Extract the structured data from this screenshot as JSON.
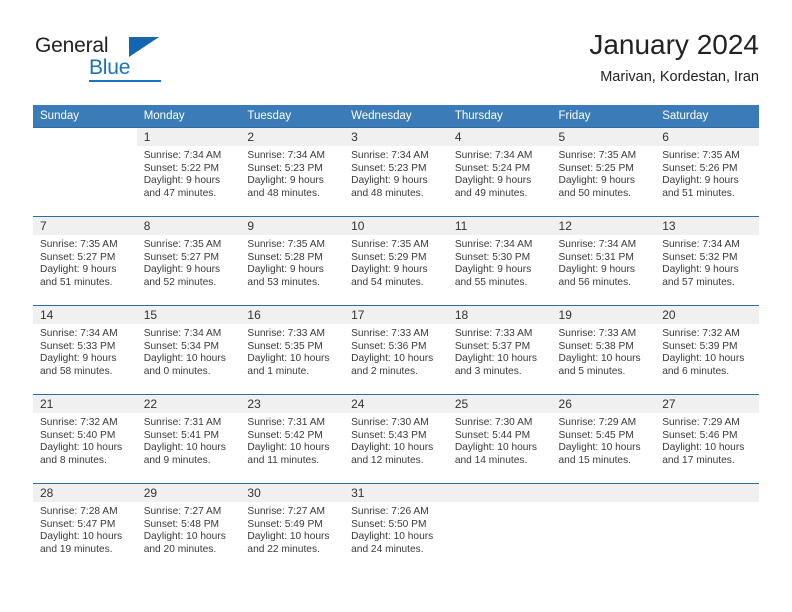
{
  "brand": {
    "name_part1": "General",
    "name_part2": "Blue"
  },
  "header": {
    "title": "January 2024",
    "subtitle": "Marivan, Kordestan, Iran"
  },
  "weekday_headers": [
    "Sunday",
    "Monday",
    "Tuesday",
    "Wednesday",
    "Thursday",
    "Friday",
    "Saturday"
  ],
  "colors": {
    "header_blue": "#3b7cb8",
    "border_blue": "#2e6da4",
    "daynum_bg": "#f0f0f0",
    "brand_blue": "#1b72bd",
    "text": "#3a3a3a"
  },
  "weeks": [
    [
      {
        "day": "",
        "empty": true,
        "lines": []
      },
      {
        "day": "1",
        "lines": [
          "Sunrise: 7:34 AM",
          "Sunset: 5:22 PM",
          "Daylight: 9 hours",
          "and 47 minutes."
        ]
      },
      {
        "day": "2",
        "lines": [
          "Sunrise: 7:34 AM",
          "Sunset: 5:23 PM",
          "Daylight: 9 hours",
          "and 48 minutes."
        ]
      },
      {
        "day": "3",
        "lines": [
          "Sunrise: 7:34 AM",
          "Sunset: 5:23 PM",
          "Daylight: 9 hours",
          "and 48 minutes."
        ]
      },
      {
        "day": "4",
        "lines": [
          "Sunrise: 7:34 AM",
          "Sunset: 5:24 PM",
          "Daylight: 9 hours",
          "and 49 minutes."
        ]
      },
      {
        "day": "5",
        "lines": [
          "Sunrise: 7:35 AM",
          "Sunset: 5:25 PM",
          "Daylight: 9 hours",
          "and 50 minutes."
        ]
      },
      {
        "day": "6",
        "lines": [
          "Sunrise: 7:35 AM",
          "Sunset: 5:26 PM",
          "Daylight: 9 hours",
          "and 51 minutes."
        ]
      }
    ],
    [
      {
        "day": "7",
        "lines": [
          "Sunrise: 7:35 AM",
          "Sunset: 5:27 PM",
          "Daylight: 9 hours",
          "and 51 minutes."
        ]
      },
      {
        "day": "8",
        "lines": [
          "Sunrise: 7:35 AM",
          "Sunset: 5:27 PM",
          "Daylight: 9 hours",
          "and 52 minutes."
        ]
      },
      {
        "day": "9",
        "lines": [
          "Sunrise: 7:35 AM",
          "Sunset: 5:28 PM",
          "Daylight: 9 hours",
          "and 53 minutes."
        ]
      },
      {
        "day": "10",
        "lines": [
          "Sunrise: 7:35 AM",
          "Sunset: 5:29 PM",
          "Daylight: 9 hours",
          "and 54 minutes."
        ]
      },
      {
        "day": "11",
        "lines": [
          "Sunrise: 7:34 AM",
          "Sunset: 5:30 PM",
          "Daylight: 9 hours",
          "and 55 minutes."
        ]
      },
      {
        "day": "12",
        "lines": [
          "Sunrise: 7:34 AM",
          "Sunset: 5:31 PM",
          "Daylight: 9 hours",
          "and 56 minutes."
        ]
      },
      {
        "day": "13",
        "lines": [
          "Sunrise: 7:34 AM",
          "Sunset: 5:32 PM",
          "Daylight: 9 hours",
          "and 57 minutes."
        ]
      }
    ],
    [
      {
        "day": "14",
        "lines": [
          "Sunrise: 7:34 AM",
          "Sunset: 5:33 PM",
          "Daylight: 9 hours",
          "and 58 minutes."
        ]
      },
      {
        "day": "15",
        "lines": [
          "Sunrise: 7:34 AM",
          "Sunset: 5:34 PM",
          "Daylight: 10 hours",
          "and 0 minutes."
        ]
      },
      {
        "day": "16",
        "lines": [
          "Sunrise: 7:33 AM",
          "Sunset: 5:35 PM",
          "Daylight: 10 hours",
          "and 1 minute."
        ]
      },
      {
        "day": "17",
        "lines": [
          "Sunrise: 7:33 AM",
          "Sunset: 5:36 PM",
          "Daylight: 10 hours",
          "and 2 minutes."
        ]
      },
      {
        "day": "18",
        "lines": [
          "Sunrise: 7:33 AM",
          "Sunset: 5:37 PM",
          "Daylight: 10 hours",
          "and 3 minutes."
        ]
      },
      {
        "day": "19",
        "lines": [
          "Sunrise: 7:33 AM",
          "Sunset: 5:38 PM",
          "Daylight: 10 hours",
          "and 5 minutes."
        ]
      },
      {
        "day": "20",
        "lines": [
          "Sunrise: 7:32 AM",
          "Sunset: 5:39 PM",
          "Daylight: 10 hours",
          "and 6 minutes."
        ]
      }
    ],
    [
      {
        "day": "21",
        "lines": [
          "Sunrise: 7:32 AM",
          "Sunset: 5:40 PM",
          "Daylight: 10 hours",
          "and 8 minutes."
        ]
      },
      {
        "day": "22",
        "lines": [
          "Sunrise: 7:31 AM",
          "Sunset: 5:41 PM",
          "Daylight: 10 hours",
          "and 9 minutes."
        ]
      },
      {
        "day": "23",
        "lines": [
          "Sunrise: 7:31 AM",
          "Sunset: 5:42 PM",
          "Daylight: 10 hours",
          "and 11 minutes."
        ]
      },
      {
        "day": "24",
        "lines": [
          "Sunrise: 7:30 AM",
          "Sunset: 5:43 PM",
          "Daylight: 10 hours",
          "and 12 minutes."
        ]
      },
      {
        "day": "25",
        "lines": [
          "Sunrise: 7:30 AM",
          "Sunset: 5:44 PM",
          "Daylight: 10 hours",
          "and 14 minutes."
        ]
      },
      {
        "day": "26",
        "lines": [
          "Sunrise: 7:29 AM",
          "Sunset: 5:45 PM",
          "Daylight: 10 hours",
          "and 15 minutes."
        ]
      },
      {
        "day": "27",
        "lines": [
          "Sunrise: 7:29 AM",
          "Sunset: 5:46 PM",
          "Daylight: 10 hours",
          "and 17 minutes."
        ]
      }
    ],
    [
      {
        "day": "28",
        "lines": [
          "Sunrise: 7:28 AM",
          "Sunset: 5:47 PM",
          "Daylight: 10 hours",
          "and 19 minutes."
        ]
      },
      {
        "day": "29",
        "lines": [
          "Sunrise: 7:27 AM",
          "Sunset: 5:48 PM",
          "Daylight: 10 hours",
          "and 20 minutes."
        ]
      },
      {
        "day": "30",
        "lines": [
          "Sunrise: 7:27 AM",
          "Sunset: 5:49 PM",
          "Daylight: 10 hours",
          "and 22 minutes."
        ]
      },
      {
        "day": "31",
        "lines": [
          "Sunrise: 7:26 AM",
          "Sunset: 5:50 PM",
          "Daylight: 10 hours",
          "and 24 minutes."
        ]
      },
      {
        "day": "",
        "empty_filled": true,
        "lines": []
      },
      {
        "day": "",
        "empty_filled": true,
        "lines": []
      },
      {
        "day": "",
        "empty_filled": true,
        "lines": []
      }
    ]
  ]
}
